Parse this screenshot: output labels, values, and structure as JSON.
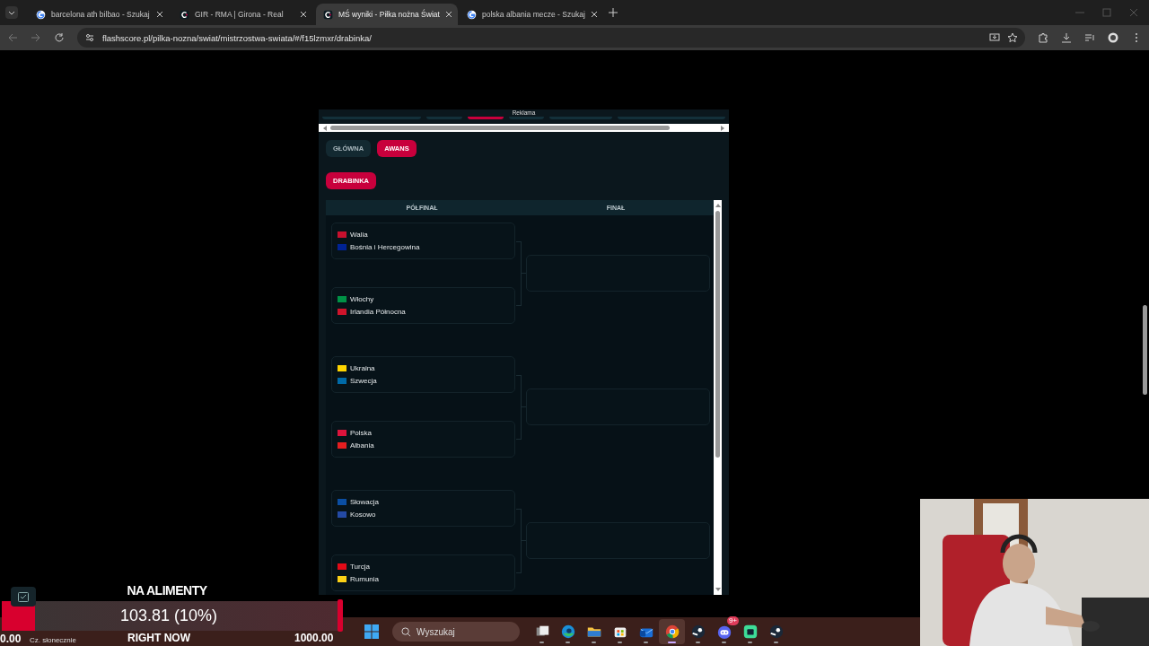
{
  "browser": {
    "tabs": [
      {
        "title": "barcelona ath bilbao - Szukaj",
        "kind": "google",
        "selected": false
      },
      {
        "title": "GIR - RMA | Girona - Real",
        "kind": "site",
        "selected": false
      },
      {
        "title": "MŚ wyniki - Piłka nożna Świat",
        "kind": "site",
        "selected": true
      },
      {
        "title": "polska albania mecze - Szukaj",
        "kind": "google",
        "selected": false
      }
    ],
    "url": "flashscore.pl/pilka-nozna/swiat/mistrzostwa-swiata/#/f15lzmxr/drabinka/"
  },
  "ad": {
    "label": "Reklama"
  },
  "tabs": [
    {
      "label": "GŁÓWNA",
      "selected": false
    },
    {
      "label": "AWANS",
      "selected": true
    }
  ],
  "subtabs": [
    {
      "label": "DRABINKA",
      "selected": true
    }
  ],
  "bracket": {
    "columns": [
      "PÓŁFINAŁ",
      "FINAŁ"
    ],
    "pairs": [
      {
        "matches": [
          {
            "teams": [
              {
                "name": "Walia",
                "color": "#c8102e"
              },
              {
                "name": "Bośnia i Hercegowina",
                "color": "#002395"
              }
            ]
          },
          {
            "teams": [
              {
                "name": "Włochy",
                "color": "#009246"
              },
              {
                "name": "Irlandia Północna",
                "color": "#cf142b"
              }
            ]
          }
        ]
      },
      {
        "matches": [
          {
            "teams": [
              {
                "name": "Ukraina",
                "color": "#ffd500"
              },
              {
                "name": "Szwecja",
                "color": "#006aa7"
              }
            ]
          },
          {
            "teams": [
              {
                "name": "Polska",
                "color": "#dc143c"
              },
              {
                "name": "Albania",
                "color": "#e41e20"
              }
            ]
          }
        ]
      },
      {
        "matches": [
          {
            "teams": [
              {
                "name": "Słowacja",
                "color": "#0b4ea2"
              },
              {
                "name": "Kosowo",
                "color": "#244aa5"
              }
            ]
          },
          {
            "teams": [
              {
                "name": "Turcja",
                "color": "#e30a17"
              },
              {
                "name": "Rumunia",
                "color": "#fcd116"
              }
            ]
          }
        ]
      }
    ]
  },
  "overlay": {
    "title": "NA ALIMENTY",
    "reading": "103.81 (10%)",
    "level": 0.1,
    "min": "0.00",
    "caption": "RIGHT NOW",
    "max": "1000.00"
  },
  "taskbar": {
    "weather": "Cz. słonecznie",
    "search_placeholder": "Wyszukaj",
    "apps": [
      {
        "kind": "taskview",
        "active": false
      },
      {
        "kind": "edge",
        "active": false
      },
      {
        "kind": "folder",
        "active": false
      },
      {
        "kind": "store",
        "active": false
      },
      {
        "kind": "mail",
        "active": false
      },
      {
        "kind": "chrome",
        "active": true
      },
      {
        "kind": "steam",
        "active": false
      },
      {
        "kind": "discord",
        "active": false,
        "badge": "9+"
      },
      {
        "kind": "app",
        "active": false
      },
      {
        "kind": "steam",
        "active": false
      }
    ]
  }
}
